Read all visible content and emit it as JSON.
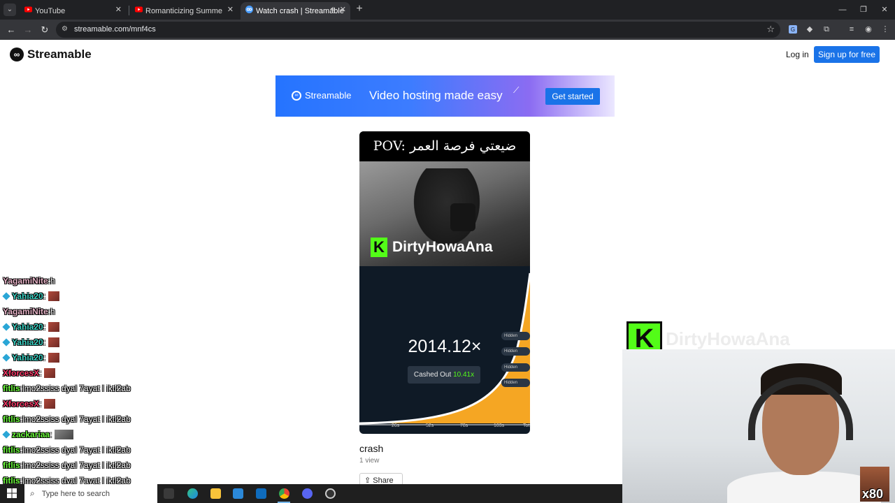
{
  "browser": {
    "tabs": [
      {
        "title": "YouTube",
        "active": false,
        "icon": "youtube-icon"
      },
      {
        "title": "Romanticizing Summer in the n",
        "active": false,
        "icon": "youtube-icon"
      },
      {
        "title": "Watch crash | Streamable",
        "active": true,
        "icon": "streamable-icon",
        "audio": true
      }
    ],
    "url": "streamable.com/mnf4cs"
  },
  "page": {
    "logo_text": "Streamable",
    "login_label": "Log in",
    "signup_label": "Sign up for free",
    "banner": {
      "brand": "Streamable",
      "tagline": "Video hosting made easy",
      "cta": "Get started"
    },
    "video": {
      "caption": "POV: ضيعتي فرصة العمر",
      "kick_channel": "DirtyHowaAna",
      "multiplier": "2014.12×",
      "cashed_label": "Cashed Out",
      "cashed_value": "10.41x",
      "axis_ticks": [
        "26s",
        "52s",
        "78s",
        "103s",
        "Tot"
      ],
      "hidden_label": "Hidden",
      "title": "crash",
      "views": "1 view",
      "share_label": "Share"
    }
  },
  "chat": [
    {
      "user": "YagamiNite",
      "msg": "h",
      "color": "#e8b4c8",
      "badge": false,
      "emote": false
    },
    {
      "user": "Yahia20",
      "msg": "",
      "color": "#3cd3c5",
      "badge": true,
      "emote": true
    },
    {
      "user": "YagamiNite",
      "msg": "h",
      "color": "#e8b4c8",
      "badge": false,
      "emote": false
    },
    {
      "user": "Yahia20",
      "msg": "",
      "color": "#3cd3c5",
      "badge": true,
      "emote": true
    },
    {
      "user": "Yahia20",
      "msg": "",
      "color": "#3cd3c5",
      "badge": true,
      "emote": true
    },
    {
      "user": "Yahia20",
      "msg": "",
      "color": "#3cd3c5",
      "badge": true,
      "emote": true
    },
    {
      "user": "XforcesX",
      "msg": "",
      "color": "#ff3b6b",
      "badge": false,
      "emote": true
    },
    {
      "user": "fitlis",
      "msg": "lmo2ssiss dyal 7ayat l ikti2ab",
      "color": "#6cff3c",
      "badge": false,
      "emote": false
    },
    {
      "user": "XforcesX",
      "msg": "",
      "color": "#ff3b6b",
      "badge": false,
      "emote": true
    },
    {
      "user": "fitlis",
      "msg": "lmo2ssiss dyal 7ayat l ikti2ab",
      "color": "#6cff3c",
      "badge": false,
      "emote": false
    },
    {
      "user": "zackariaa",
      "msg": "",
      "color": "#6cff3c",
      "badge": true,
      "emote": true,
      "wide": true
    },
    {
      "user": "fitlis",
      "msg": "lmo2ssiss dyal 7ayat l ikti2ab",
      "color": "#6cff3c",
      "badge": false,
      "emote": false
    },
    {
      "user": "fitlis",
      "msg": "lmo2ssiss dyal 7ayat l ikti2ab",
      "color": "#6cff3c",
      "badge": false,
      "emote": false
    },
    {
      "user": "fitlis",
      "msg": "lmo2ssiss dyal 7ayat l ikti2ab",
      "color": "#6cff3c",
      "badge": false,
      "emote": false
    }
  ],
  "stream_overlay": {
    "kick_letter": "K",
    "ghost_name": "DirtyHowaAna",
    "sub_multiplier": "x80"
  },
  "taskbar": {
    "search_placeholder": "Type here to search"
  },
  "colors": {
    "kick_green": "#53fc18",
    "streamable_blue": "#1a73e8"
  }
}
